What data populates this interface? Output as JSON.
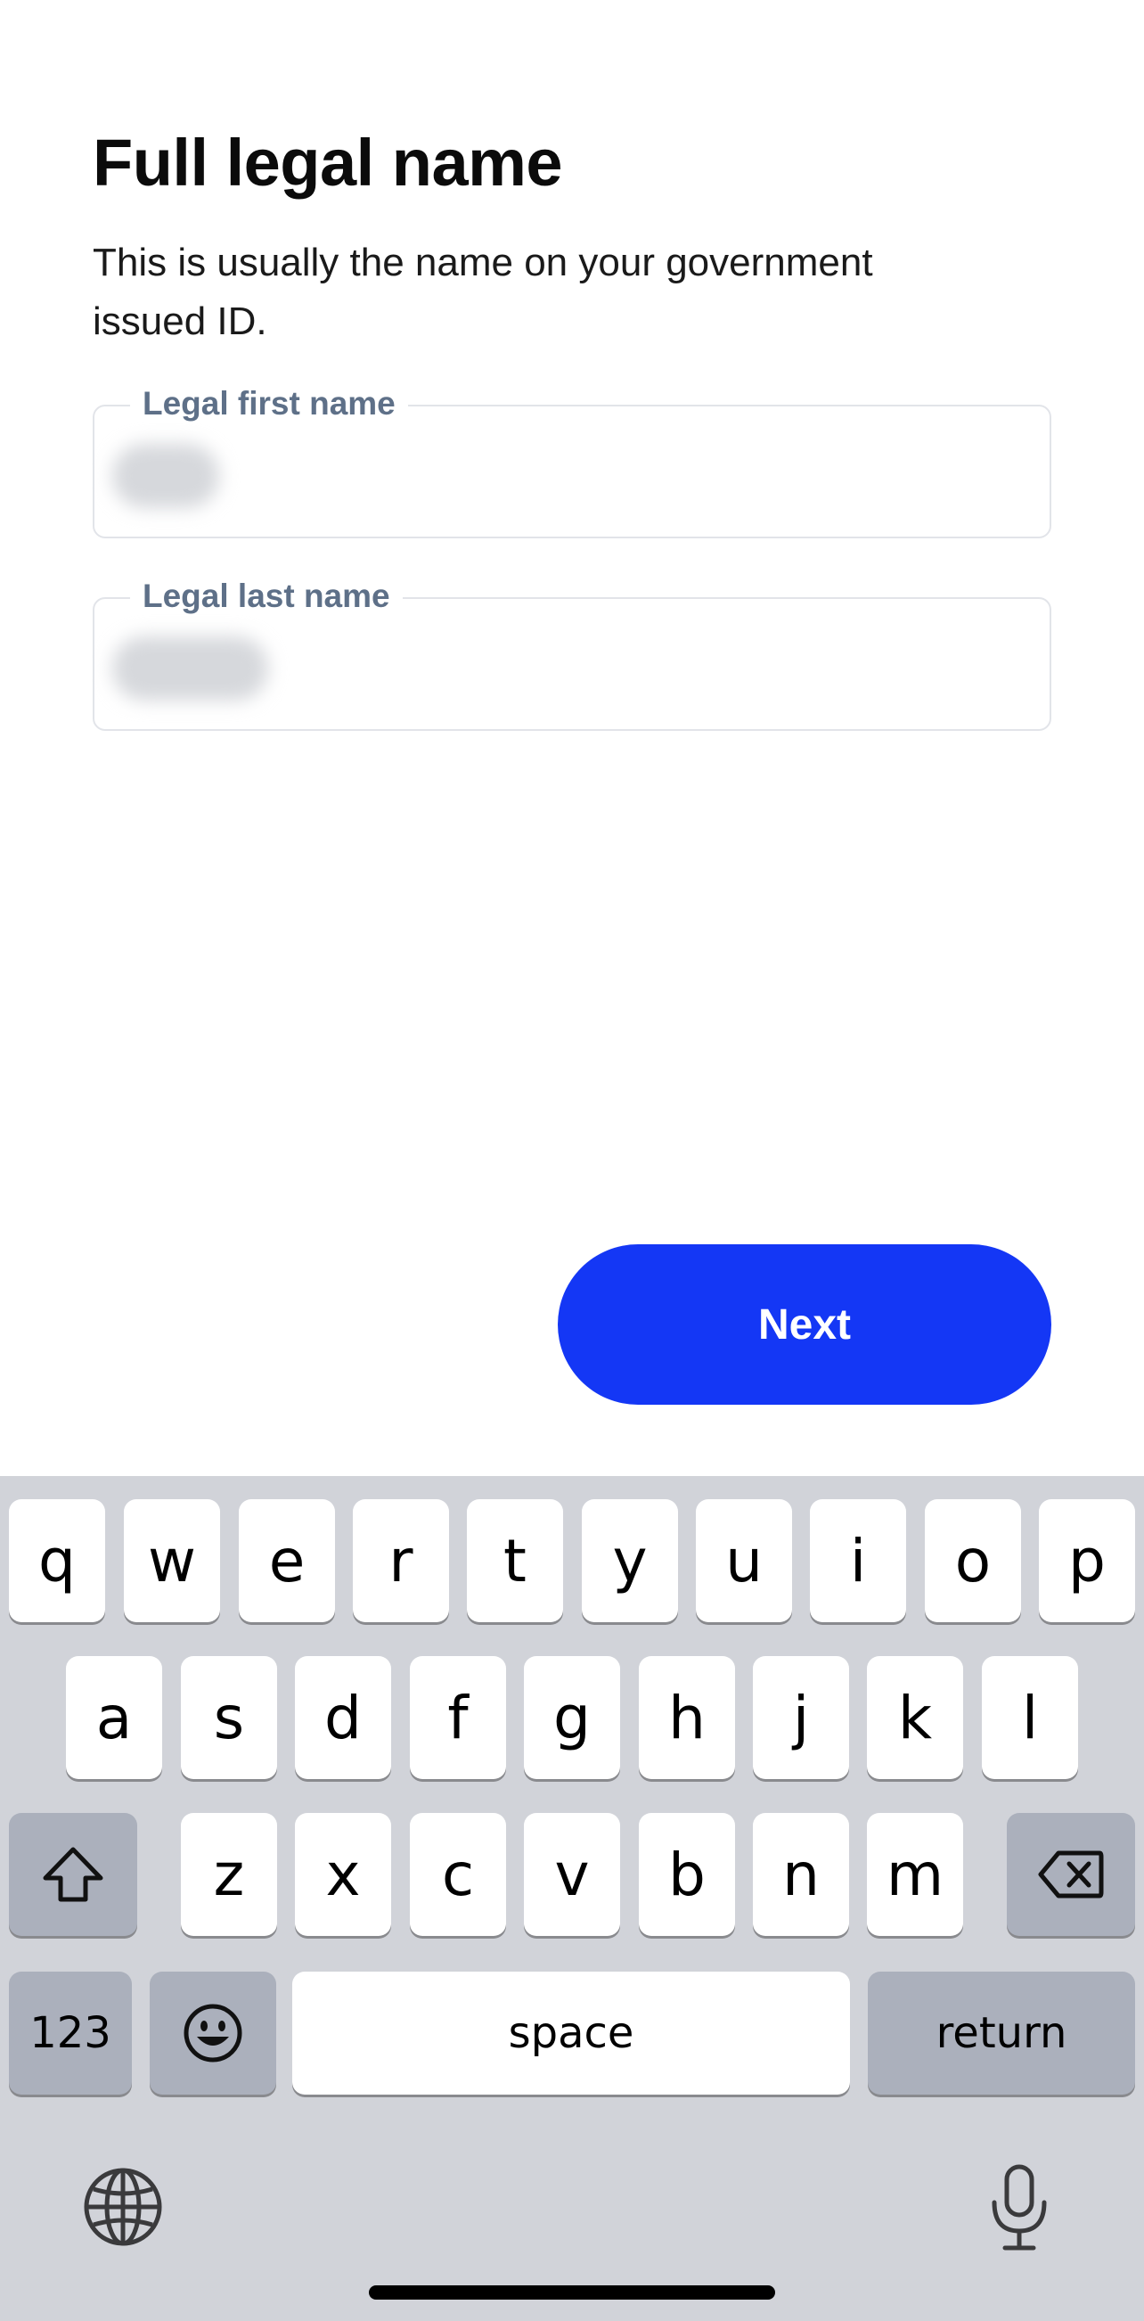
{
  "page": {
    "title": "Full legal name",
    "subtitle": "This is usually the name on your government issued ID."
  },
  "form": {
    "first_name": {
      "label": "Legal first name",
      "value": ""
    },
    "last_name": {
      "label": "Legal last name",
      "value": ""
    },
    "next_label": "Next"
  },
  "keyboard": {
    "row1": [
      "q",
      "w",
      "e",
      "r",
      "t",
      "y",
      "u",
      "i",
      "o",
      "p"
    ],
    "row2": [
      "a",
      "s",
      "d",
      "f",
      "g",
      "h",
      "j",
      "k",
      "l"
    ],
    "row3": [
      "z",
      "x",
      "c",
      "v",
      "b",
      "n",
      "m"
    ],
    "numbers_label": "123",
    "space_label": "space",
    "return_label": "return",
    "icons": {
      "shift": "shift-icon",
      "delete": "backspace-icon",
      "emoji": "emoji-icon",
      "globe": "globe-icon",
      "mic": "microphone-icon"
    }
  },
  "colors": {
    "accent": "#1437f5",
    "label": "#5e7088",
    "keyboard_bg": "#d1d3d9",
    "function_key": "#abb0bc"
  }
}
